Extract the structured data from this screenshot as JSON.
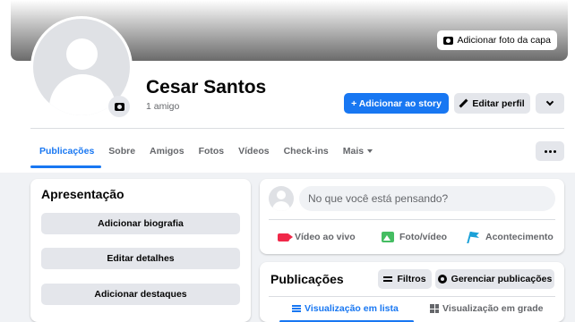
{
  "profile": {
    "name": "Cesar Santos",
    "friends": "1 amigo",
    "add_cover_label": "Adicionar foto da capa",
    "add_story_label": "+ Adicionar ao story",
    "edit_profile_label": "Editar perfil"
  },
  "tabs": [
    {
      "label": "Publicações",
      "active": true
    },
    {
      "label": "Sobre"
    },
    {
      "label": "Amigos"
    },
    {
      "label": "Fotos"
    },
    {
      "label": "Vídeos"
    },
    {
      "label": "Check-ins"
    },
    {
      "label": "Mais"
    }
  ],
  "intro": {
    "title": "Apresentação",
    "buttons": [
      "Adicionar biografia",
      "Editar detalhes",
      "Adicionar destaques"
    ]
  },
  "composer": {
    "placeholder": "No que você está pensando?",
    "actions": [
      "Vídeo ao vivo",
      "Foto/vídeo",
      "Acontecimento"
    ]
  },
  "posts": {
    "title": "Publicações",
    "filters_label": "Filtros",
    "manage_label": "Gerenciar publicações",
    "list_view_label": "Visualização em lista",
    "grid_view_label": "Visualização em grade"
  },
  "colors": {
    "accent": "#1877f2",
    "live": "#f02849",
    "photo": "#45bd62",
    "event": "#1ba1d8"
  }
}
